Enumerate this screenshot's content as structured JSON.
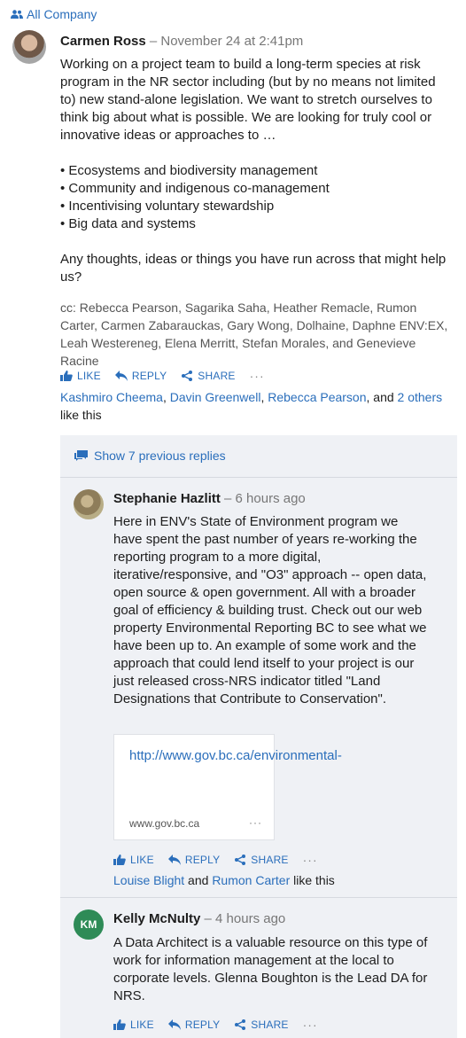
{
  "group": {
    "label": "All Company"
  },
  "post": {
    "author": "Carmen Ross",
    "time": "– November 24 at 2:41pm",
    "body": "Working on a project team to build a long-term species at risk program in the NR sector including (but by no means not limited to) new stand-alone legislation. We want to stretch ourselves to think big about what is possible. We are looking for truly cool or innovative ideas or approaches to …\n\n• Ecosystems and biodiversity management\n• Community and indigenous co-management\n• Incentivising voluntary stewardship\n• Big data and systems\n\nAny thoughts, ideas or things you have run across that might help us?",
    "cc": "cc: Rebecca Pearson, Sagarika Saha, Heather Remacle, Rumon Carter, Carmen Zabarauckas, Gary Wong, Dolhaine, Daphne ENV:EX, Leah Westereneg, Elena Merritt, Stefan Morales, and Genevieve Racine",
    "actions": {
      "like": "LIKE",
      "reply": "REPLY",
      "share": "SHARE",
      "more": "···"
    },
    "likes": {
      "names": [
        "Kashmiro Cheema",
        "Davin Greenwell",
        "Rebecca Pearson"
      ],
      "sep1": ", ",
      "sep2": ", ",
      "and": ", and ",
      "others": "2 others",
      "suffix": " like this"
    }
  },
  "thread": {
    "show_previous": "Show 7 previous replies",
    "replies": [
      {
        "author": "Stephanie Hazlitt",
        "time": "– 6 hours ago",
        "body": "Here in ENV's State of Environment program we have spent the past number of years re-working the reporting program to a more digital, iterative/responsive, and \"O3\" approach -- open data, open source & open government. All with a broader goal of efficiency & building trust. Check out our web property Environmental Reporting BC to see what we have been up to. An example of some work and the approach that could lend itself to your project is our just released cross-NRS indicator titled \"Land Designations that Contribute to Conservation\".",
        "link_card": {
          "url": "http://www.gov.bc.ca/environmental-",
          "domain": "www.gov.bc.ca",
          "more": "···"
        },
        "actions": {
          "like": "LIKE",
          "reply": "REPLY",
          "share": "SHARE",
          "more": "···"
        },
        "likes": {
          "name1": "Louise Blight",
          "and": " and ",
          "name2": "Rumon Carter",
          "suffix": " like this"
        }
      },
      {
        "author": "Kelly McNulty",
        "initials": "KM",
        "time": "– 4 hours ago",
        "body": "A Data Architect is a valuable resource on this type of work for information management at the local to corporate levels. Glenna Boughton is the Lead DA for NRS.",
        "actions": {
          "like": "LIKE",
          "reply": "REPLY",
          "share": "SHARE",
          "more": "···"
        }
      }
    ]
  },
  "colors": {
    "link": "#2a6ebb",
    "thread_bg": "#eff1f5",
    "km_avatar": "#2e8b57"
  }
}
